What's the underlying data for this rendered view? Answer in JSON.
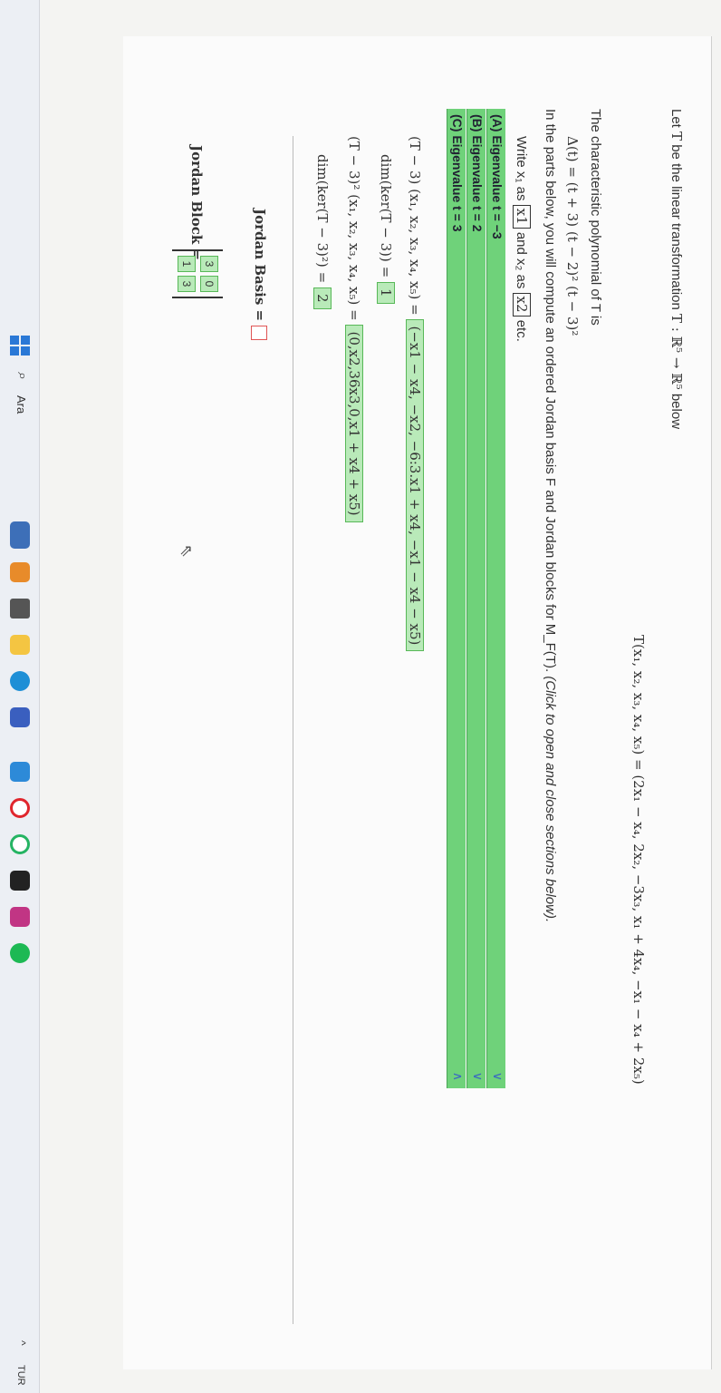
{
  "problem": {
    "intro_pre": "Let",
    "T": "T",
    "intro_mid": "be the linear transformation",
    "map": "T : ℝ⁵ → ℝ⁵",
    "intro_post": "below",
    "definition": "T(x₁, x₂, x₃, x₄, x₅) = (2x₁ − x₄, 2x₂, −3x₃, x₁ + 4x₄, −x₁ − x₄ + 2x₅)",
    "charpoly_label": "The characteristic polynomial of T is",
    "charpoly": "Δ(t) = (t + 3) (t − 2)² (t − 3)²",
    "instructions": "In the parts below, you will compute an ordered Jordan basis F and Jordan blocks for M_F(T).",
    "instructions_italic": "(Click to open and close sections below).",
    "write_pre": "Write x₁ as",
    "write_box1": "x1",
    "write_mid": "and x₂ as",
    "write_box2": "x2",
    "write_post": "etc."
  },
  "sections": [
    {
      "label": "(A) Eigenvalue t = −3",
      "chevron": "∨"
    },
    {
      "label": "(B) Eigenvalue t = 2",
      "chevron": "∨"
    },
    {
      "label": "(C) Eigenvalue t = 3",
      "chevron": "∧"
    }
  ],
  "section_c": {
    "row1_lhs": "(T − 3) (x₁, x₂, x₃, x₄, x₅) =",
    "row1_ans": "(−x1 − x4, −x2, −6:3.x1 + x4, −x1 − x4 − x5)",
    "row2_lhs": "dim(ker(T − 3)) =",
    "row2_ans": "1",
    "row3_lhs": "(T − 3)² (x₁, x₂, x₃, x₄, x₅) =",
    "row3_ans": "(0,x2,36x3,0,x1 + x4 + x5)",
    "row4_lhs": "dim(ker(T − 3)²) =",
    "row4_ans": "2",
    "basis_label": "Jordan Basis =",
    "block_label": "Jordan Block =",
    "block": [
      "3",
      "0",
      "1",
      "3"
    ]
  },
  "taskbar": {
    "search_icon": "search-icon",
    "search_text": "Ara",
    "tray_text": "TUR",
    "apps": [
      "windows-start-icon",
      "search-icon",
      "weather-icon",
      "edu-app-icon",
      "task-view-icon",
      "file-explorer-icon",
      "edge-icon",
      "store-icon",
      "outlook-icon",
      "opera-icon",
      "whatsapp-icon",
      "notion-icon",
      "instagram-icon",
      "spotify-icon"
    ]
  }
}
